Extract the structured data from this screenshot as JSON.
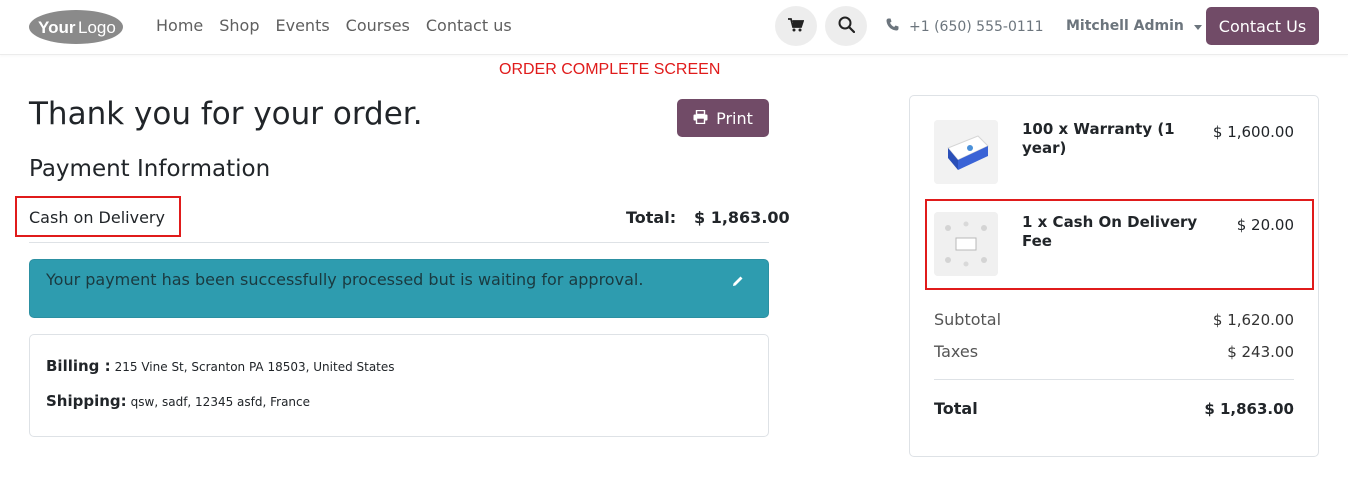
{
  "header": {
    "logo_text": "YourLogo",
    "nav": [
      "Home",
      "Shop",
      "Events",
      "Courses",
      "Contact us"
    ],
    "phone": "+1 (650) 555-0111",
    "user_name": "Mitchell Admin",
    "contact_button": "Contact Us",
    "accent_color": "#714b67"
  },
  "annotation": {
    "title": "ORDER COMPLETE SCREEN",
    "color": "#e01b1b"
  },
  "order": {
    "heading": "Thank you for your order.",
    "print_label": "Print",
    "payment_title": "Payment Information",
    "payment_method": "Cash on Delivery",
    "total_label": "Total:",
    "total_value": "$ 1,863.00",
    "alert_message": "Your payment has been successfully processed but is waiting for approval.",
    "alert_color": "#2e9caf",
    "billing_label": "Billing :",
    "billing_value": "215 Vine St, Scranton PA 18503, United States",
    "shipping_label": "Shipping:",
    "shipping_value": "qsw, sadf, 12345 asfd, France"
  },
  "summary": {
    "items": [
      {
        "name": "100 x Warranty (1 year)",
        "price": "$ 1,600.00",
        "icon": "warranty-box-icon"
      },
      {
        "name": "1 x Cash On Delivery Fee",
        "price": "$ 20.00",
        "icon": "delivery-fee-icon"
      }
    ],
    "subtotal_label": "Subtotal",
    "subtotal_value": "$ 1,620.00",
    "taxes_label": "Taxes",
    "taxes_value": "$ 243.00",
    "total_label": "Total",
    "total_value": "$ 1,863.00"
  }
}
